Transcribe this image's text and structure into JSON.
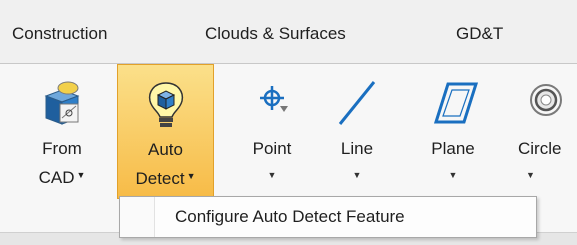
{
  "tabs": [
    {
      "label": "Construction"
    },
    {
      "label": "Clouds & Surfaces"
    },
    {
      "label": "GD&T"
    }
  ],
  "ribbon": {
    "buttons": [
      {
        "line1": "From",
        "line2": "CAD",
        "icon": "cad-cube-icon"
      },
      {
        "line1": "Auto",
        "line2": "Detect",
        "icon": "lightbulb-cube-icon",
        "state": "active"
      },
      {
        "line1": "Point",
        "icon": "point-crosshair-icon"
      },
      {
        "line1": "Line",
        "icon": "line-icon"
      },
      {
        "line1": "Plane",
        "icon": "plane-icon"
      },
      {
        "line1": "Circle",
        "icon": "circle-icon"
      }
    ],
    "caret": "▼"
  },
  "menu": {
    "items": [
      {
        "label": "Configure Auto Detect Feature"
      }
    ]
  },
  "colors": {
    "active_top": "#fbe08a",
    "active_bottom": "#f7bb47",
    "icon_blue": "#1a6fc0"
  }
}
